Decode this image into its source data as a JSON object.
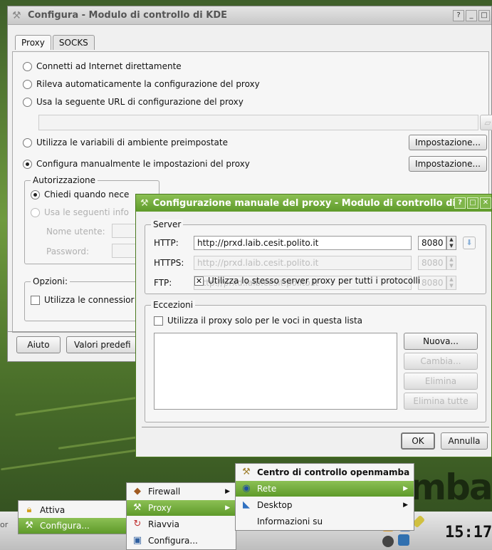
{
  "main_window": {
    "title": "Configura - Modulo di controllo di KDE",
    "title_buttons": [
      "?",
      "_",
      "□"
    ],
    "tabs": [
      "Proxy",
      "SOCKS"
    ],
    "radio_options": [
      {
        "label": "Connetti ad Internet direttamente",
        "checked": false
      },
      {
        "label": "Rileva automaticamente la configurazione del proxy",
        "checked": false
      },
      {
        "label": "Usa la seguente URL di configurazione del proxy",
        "checked": false
      },
      {
        "label": "Utilizza le variabili di ambiente preimpostate",
        "checked": false
      },
      {
        "label": "Configura manualmente le impostazioni del proxy",
        "checked": true
      }
    ],
    "url_field_value": "",
    "settings_button_1": "Impostazione...",
    "settings_button_2": "Impostazione...",
    "auth_group": {
      "title": "Autorizzazione",
      "option_ask": "Chiedi quando nece",
      "option_use": "Usa le seguenti info",
      "username_label": "Nome utente:",
      "password_label": "Password:"
    },
    "options_group": {
      "title": "Opzioni:",
      "checkbox_label": "Utilizza le connessior"
    },
    "help_button": "Aiuto",
    "defaults_button": "Valori predefi"
  },
  "dialog": {
    "title": "Configurazione manuale del proxy - Modulo di controllo di I",
    "server_group_title": "Server",
    "http_label": "HTTP:",
    "http_value": "http://prxd.laib.cesit.polito.it",
    "http_port": "8080",
    "https_label": "HTTPS:",
    "https_value": "http://prxd.laib.cesit.polito.it",
    "https_port": "8080",
    "ftp_label": "FTP:",
    "ftp_value": "http://prxd.laib.cesit.polito.it",
    "ftp_port": "8080",
    "same_server_label": "Utilizza lo stesso server proxy per tutti i protocolli",
    "same_server_checked": true,
    "exceptions_group_title": "Eccezioni",
    "only_list_label": "Utilizza il proxy solo per le voci in questa lista",
    "only_list_checked": false,
    "buttons": {
      "new": "Nuova...",
      "change": "Cambia...",
      "delete": "Elimina",
      "delete_all": "Elimina tutte"
    },
    "ok_button": "OK",
    "cancel_button": "Annulla"
  },
  "menus": {
    "level1": [
      {
        "label": "Attiva",
        "icon": "lock-icon",
        "selected": false
      },
      {
        "label": "Configura...",
        "icon": "wrench-icon",
        "selected": true
      }
    ],
    "level2": [
      {
        "label": "Firewall",
        "icon": "firewall-icon",
        "selected": false,
        "submenu": true
      },
      {
        "label": "Proxy",
        "icon": "proxy-icon",
        "selected": true,
        "submenu": true
      },
      {
        "label": "Riavvia",
        "icon": "restart-icon",
        "selected": false,
        "submenu": false
      },
      {
        "label": "Configura...",
        "icon": "network-config-icon",
        "selected": false,
        "submenu": false
      }
    ],
    "level3_header": "Centro di controllo openmamba",
    "level3": [
      {
        "label": "Rete",
        "icon": "globe-icon",
        "selected": true,
        "submenu": true
      },
      {
        "label": "Desktop",
        "icon": "desktop-icon",
        "selected": false,
        "submenu": true
      },
      {
        "label": "Informazioni su",
        "icon": "",
        "selected": false,
        "submenu": false
      }
    ]
  },
  "desktop": {
    "brand_text": "mba",
    "clock": "15:17",
    "taskbar_left_text": "or"
  },
  "colors": {
    "accent": "#6fa83a",
    "accent_dark": "#4a7a1f"
  }
}
